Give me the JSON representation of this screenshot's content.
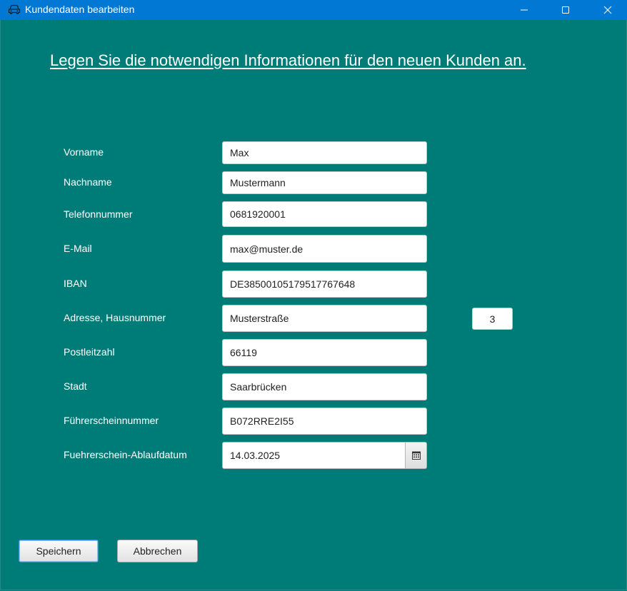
{
  "window": {
    "title": "Kundendaten bearbeiten",
    "icon": "car-icon",
    "controls": [
      "minimize-icon",
      "maximize-icon",
      "close-icon"
    ]
  },
  "heading": "Legen Sie die notwendigen Informationen für den neuen Kunden an.",
  "form": {
    "vorname": {
      "label": "Vorname",
      "value": "Max"
    },
    "nachname": {
      "label": "Nachname",
      "value": "Mustermann"
    },
    "telefon": {
      "label": "Telefonnummer",
      "value": "0681920001"
    },
    "email": {
      "label": "E-Mail",
      "value": "max@muster.de"
    },
    "iban": {
      "label": "IBAN",
      "value": "DE38500105179517767648"
    },
    "adresse": {
      "label": "Adresse, Hausnummer",
      "value": "Musterstraße",
      "hausnummer": "3"
    },
    "plz": {
      "label": "Postleitzahl",
      "value": "66119"
    },
    "stadt": {
      "label": "Stadt",
      "value": "Saarbrücken"
    },
    "fuehrerschein": {
      "label": "Führerscheinnummer",
      "value": "B072RRE2I55"
    },
    "ablaufdatum": {
      "label": "Fuehrerschein-Ablaufdatum",
      "value": "14.03.2025",
      "picker_icon": "calendar-icon"
    }
  },
  "buttons": {
    "save": "Speichern",
    "cancel": "Abbrechen"
  },
  "colors": {
    "background": "#007c78",
    "titlebar": "#0078d4",
    "text": "#ffffff"
  }
}
